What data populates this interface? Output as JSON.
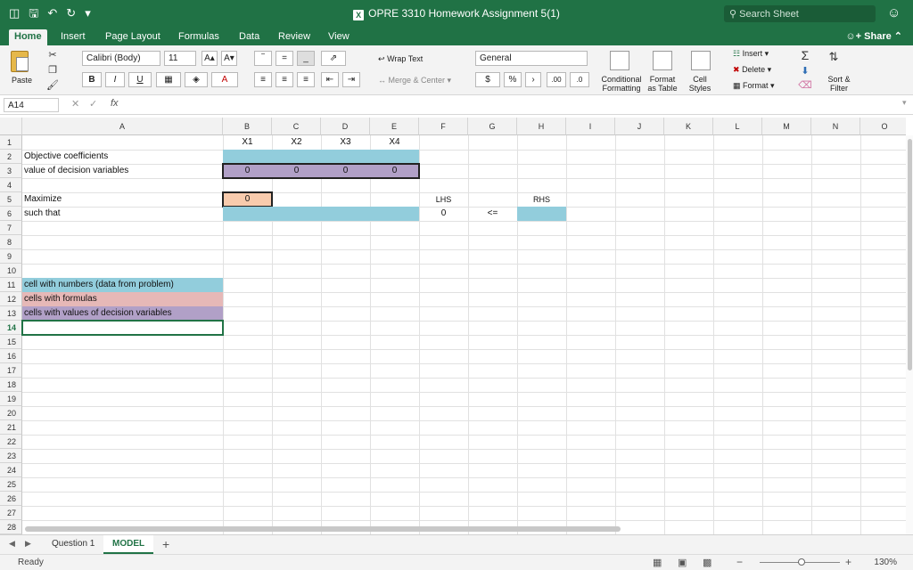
{
  "window": {
    "title": "OPRE 3310 Homework Assignment 5(1)",
    "search_placeholder": "Search Sheet"
  },
  "tabs": [
    "Home",
    "Insert",
    "Page Layout",
    "Formulas",
    "Data",
    "Review",
    "View"
  ],
  "share_label": "Share",
  "ribbon": {
    "paste": "Paste",
    "font_name": "Calibri (Body)",
    "font_size": "11",
    "bold": "B",
    "italic": "I",
    "underline": "U",
    "wrap_text": "Wrap Text",
    "merge_center": "Merge & Center",
    "number_format": "General",
    "currency": "$",
    "percent": "%",
    "comma": "›",
    "inc_decimal": ".00",
    "dec_decimal": ".0",
    "conditional_formatting_1": "Conditional",
    "conditional_formatting_2": "Formatting",
    "format_table_1": "Format",
    "format_table_2": "as Table",
    "cell_styles_1": "Cell",
    "cell_styles_2": "Styles",
    "insert": "Insert",
    "delete": "Delete",
    "format": "Format",
    "sort_filter_1": "Sort &",
    "sort_filter_2": "Filter"
  },
  "formula_bar": {
    "name_box": "A14",
    "fx": "fx",
    "content": ""
  },
  "columns": [
    "A",
    "B",
    "C",
    "D",
    "E",
    "F",
    "G",
    "H",
    "I",
    "J",
    "K",
    "L",
    "M",
    "N",
    "O"
  ],
  "rows": [
    "1",
    "2",
    "3",
    "4",
    "5",
    "6",
    "7",
    "8",
    "9",
    "10",
    "11",
    "12",
    "13",
    "14",
    "15",
    "16",
    "17",
    "18",
    "19",
    "20",
    "21",
    "22",
    "23",
    "24",
    "25",
    "26",
    "27",
    "28"
  ],
  "cells": {
    "B1": "X1",
    "C1": "X2",
    "D1": "X3",
    "E1": "X4",
    "A2": "Objective coefficients",
    "A3": "value of decision variables",
    "B3": "0",
    "C3": "0",
    "D3": "0",
    "E3": "0",
    "A5": "Maximize",
    "B5": "0",
    "F5": "LHS",
    "H5": "RHS",
    "A6": "such that",
    "F6": "0",
    "G6": "<=",
    "A11": "cell with numbers (data from problem)",
    "A12": "cells with formulas",
    "A13": "cells with values of decision variables"
  },
  "colors": {
    "excel_green": "#207245",
    "blue_fill": "#92cddc",
    "purple_fill": "#b1a0c7",
    "peach_fill": "#f8cbad",
    "pink_fill": "#e6b8b7"
  },
  "sheets": [
    "Question 1",
    "MODEL"
  ],
  "active_sheet": "MODEL",
  "status": "Ready",
  "zoom": "130%"
}
